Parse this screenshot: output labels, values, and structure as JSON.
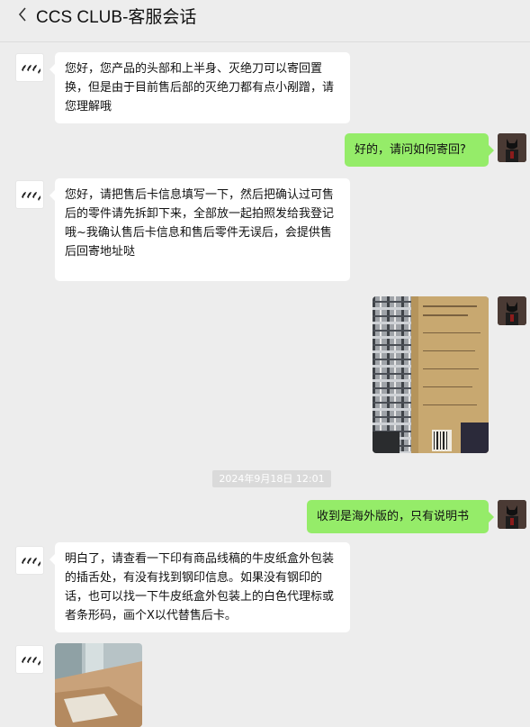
{
  "header": {
    "title": "CCS CLUB-客服会话",
    "back_icon": "chevron-left-icon"
  },
  "messages": [
    {
      "side": "left",
      "text": "您好，您产品的头部和上半身、灭绝刀可以寄回置换，但是由于目前售后部的灭绝刀都有点小剐蹭，请您理解哦"
    },
    {
      "side": "right",
      "text": "好的，请问如何寄回?"
    },
    {
      "side": "left",
      "text": "您好，请把售后卡信息填写一下，然后把确认过可售后的零件请先拆卸下来，全部放一起拍照发给我登记哦~我确认售后卡信息和售后零件无误后，会提供售后回寄地址哒"
    },
    {
      "side": "right",
      "type": "image",
      "alt": "photo of product box on plaid fabric"
    },
    {
      "side": "right",
      "text": "收到是海外版的，只有说明书"
    },
    {
      "side": "left",
      "text": "明白了，请查看一下印有商品线稿的牛皮纸盒外包装的插舌处，有没有找到钢印信息。如果没有钢印的话，也可以找一下牛皮纸盒外包装上的白色代理标或者条形码，画个X以代替售后卡。"
    },
    {
      "side": "left",
      "type": "image",
      "alt": "photo of kraft paper box"
    }
  ],
  "timestamp": "2024年9月18日 12:01",
  "colors": {
    "background": "#ededed",
    "bubble_left": "#ffffff",
    "bubble_right": "#95ec69"
  }
}
